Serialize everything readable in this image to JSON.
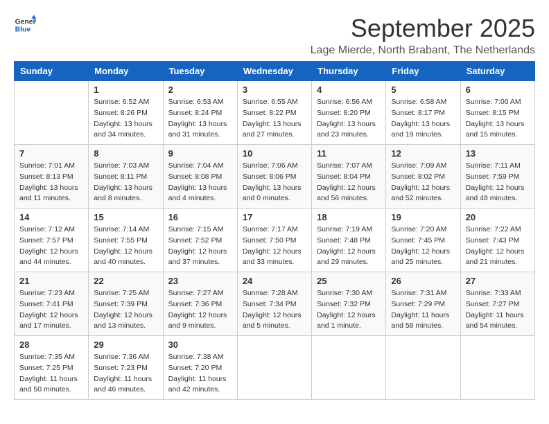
{
  "logo": {
    "line1": "General",
    "line2": "Blue"
  },
  "title": "September 2025",
  "location": "Lage Mierde, North Brabant, The Netherlands",
  "weekdays": [
    "Sunday",
    "Monday",
    "Tuesday",
    "Wednesday",
    "Thursday",
    "Friday",
    "Saturday"
  ],
  "weeks": [
    [
      {
        "day": "",
        "info": ""
      },
      {
        "day": "1",
        "info": "Sunrise: 6:52 AM\nSunset: 8:26 PM\nDaylight: 13 hours\nand 34 minutes."
      },
      {
        "day": "2",
        "info": "Sunrise: 6:53 AM\nSunset: 8:24 PM\nDaylight: 13 hours\nand 31 minutes."
      },
      {
        "day": "3",
        "info": "Sunrise: 6:55 AM\nSunset: 8:22 PM\nDaylight: 13 hours\nand 27 minutes."
      },
      {
        "day": "4",
        "info": "Sunrise: 6:56 AM\nSunset: 8:20 PM\nDaylight: 13 hours\nand 23 minutes."
      },
      {
        "day": "5",
        "info": "Sunrise: 6:58 AM\nSunset: 8:17 PM\nDaylight: 13 hours\nand 19 minutes."
      },
      {
        "day": "6",
        "info": "Sunrise: 7:00 AM\nSunset: 8:15 PM\nDaylight: 13 hours\nand 15 minutes."
      }
    ],
    [
      {
        "day": "7",
        "info": "Sunrise: 7:01 AM\nSunset: 8:13 PM\nDaylight: 13 hours\nand 11 minutes."
      },
      {
        "day": "8",
        "info": "Sunrise: 7:03 AM\nSunset: 8:11 PM\nDaylight: 13 hours\nand 8 minutes."
      },
      {
        "day": "9",
        "info": "Sunrise: 7:04 AM\nSunset: 8:08 PM\nDaylight: 13 hours\nand 4 minutes."
      },
      {
        "day": "10",
        "info": "Sunrise: 7:06 AM\nSunset: 8:06 PM\nDaylight: 13 hours\nand 0 minutes."
      },
      {
        "day": "11",
        "info": "Sunrise: 7:07 AM\nSunset: 8:04 PM\nDaylight: 12 hours\nand 56 minutes."
      },
      {
        "day": "12",
        "info": "Sunrise: 7:09 AM\nSunset: 8:02 PM\nDaylight: 12 hours\nand 52 minutes."
      },
      {
        "day": "13",
        "info": "Sunrise: 7:11 AM\nSunset: 7:59 PM\nDaylight: 12 hours\nand 48 minutes."
      }
    ],
    [
      {
        "day": "14",
        "info": "Sunrise: 7:12 AM\nSunset: 7:57 PM\nDaylight: 12 hours\nand 44 minutes."
      },
      {
        "day": "15",
        "info": "Sunrise: 7:14 AM\nSunset: 7:55 PM\nDaylight: 12 hours\nand 40 minutes."
      },
      {
        "day": "16",
        "info": "Sunrise: 7:15 AM\nSunset: 7:52 PM\nDaylight: 12 hours\nand 37 minutes."
      },
      {
        "day": "17",
        "info": "Sunrise: 7:17 AM\nSunset: 7:50 PM\nDaylight: 12 hours\nand 33 minutes."
      },
      {
        "day": "18",
        "info": "Sunrise: 7:19 AM\nSunset: 7:48 PM\nDaylight: 12 hours\nand 29 minutes."
      },
      {
        "day": "19",
        "info": "Sunrise: 7:20 AM\nSunset: 7:45 PM\nDaylight: 12 hours\nand 25 minutes."
      },
      {
        "day": "20",
        "info": "Sunrise: 7:22 AM\nSunset: 7:43 PM\nDaylight: 12 hours\nand 21 minutes."
      }
    ],
    [
      {
        "day": "21",
        "info": "Sunrise: 7:23 AM\nSunset: 7:41 PM\nDaylight: 12 hours\nand 17 minutes."
      },
      {
        "day": "22",
        "info": "Sunrise: 7:25 AM\nSunset: 7:39 PM\nDaylight: 12 hours\nand 13 minutes."
      },
      {
        "day": "23",
        "info": "Sunrise: 7:27 AM\nSunset: 7:36 PM\nDaylight: 12 hours\nand 9 minutes."
      },
      {
        "day": "24",
        "info": "Sunrise: 7:28 AM\nSunset: 7:34 PM\nDaylight: 12 hours\nand 5 minutes."
      },
      {
        "day": "25",
        "info": "Sunrise: 7:30 AM\nSunset: 7:32 PM\nDaylight: 12 hours\nand 1 minute."
      },
      {
        "day": "26",
        "info": "Sunrise: 7:31 AM\nSunset: 7:29 PM\nDaylight: 11 hours\nand 58 minutes."
      },
      {
        "day": "27",
        "info": "Sunrise: 7:33 AM\nSunset: 7:27 PM\nDaylight: 11 hours\nand 54 minutes."
      }
    ],
    [
      {
        "day": "28",
        "info": "Sunrise: 7:35 AM\nSunset: 7:25 PM\nDaylight: 11 hours\nand 50 minutes."
      },
      {
        "day": "29",
        "info": "Sunrise: 7:36 AM\nSunset: 7:23 PM\nDaylight: 11 hours\nand 46 minutes."
      },
      {
        "day": "30",
        "info": "Sunrise: 7:38 AM\nSunset: 7:20 PM\nDaylight: 11 hours\nand 42 minutes."
      },
      {
        "day": "",
        "info": ""
      },
      {
        "day": "",
        "info": ""
      },
      {
        "day": "",
        "info": ""
      },
      {
        "day": "",
        "info": ""
      }
    ]
  ]
}
